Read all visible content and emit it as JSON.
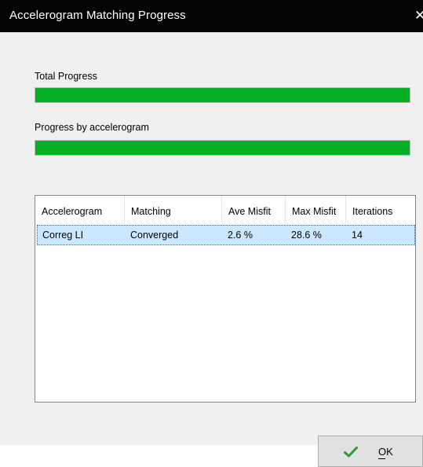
{
  "window": {
    "title": "Accelerogram Matching Progress",
    "close_icon": "close-icon"
  },
  "progress": {
    "total_label": "Total Progress",
    "total_value": 1.0,
    "by_accelerogram_label": "Progress by accelerogram",
    "by_accelerogram_value": 1.0,
    "bar_color": "#06b025"
  },
  "table": {
    "columns": [
      "Accelerogram",
      "Matching",
      "Ave Misfit",
      "Max Misfit",
      "Iterations"
    ],
    "rows": [
      [
        "Correg  LI",
        "Converged",
        "2.6 %",
        "28.6 %",
        "14"
      ]
    ],
    "selected_row_color": "#cce8ff"
  },
  "buttons": {
    "ok_label": "OK",
    "ok_icon": "checkmark-icon",
    "ok_icon_color": "#2e9e33"
  }
}
